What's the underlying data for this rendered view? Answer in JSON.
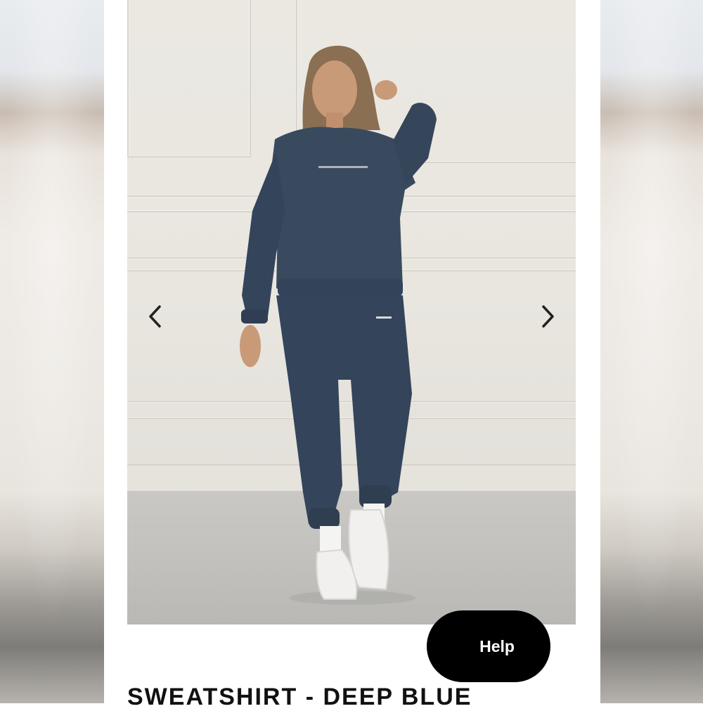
{
  "product": {
    "title": "SWEATSHIRT - DEEP BLUE",
    "image_alt": "Model wearing deep blue sweatshirt and joggers"
  },
  "carousel": {
    "prev_icon": "chevron-left-icon",
    "next_icon": "chevron-right-icon"
  },
  "help": {
    "label": "Help"
  },
  "colors": {
    "garment": "#3a4a5e",
    "button_bg": "#000000",
    "button_text": "#ffffff"
  }
}
